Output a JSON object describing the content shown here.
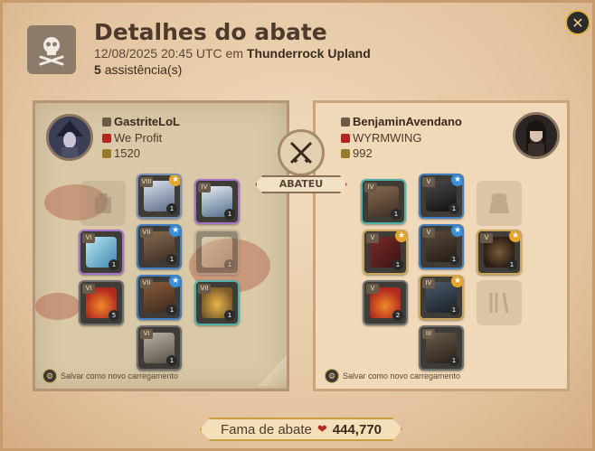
{
  "header": {
    "title": "Detalhes do abate",
    "datetime": "12/08/2025 20:45 UTC em",
    "location": "Thunderrock Upland",
    "assists_count": "5",
    "assists_label": "assistência(s)"
  },
  "killer": {
    "name": "GastriteLoL",
    "guild": "We Profit",
    "ip": "1520",
    "save_label": "Salvar como novo carregamento"
  },
  "victim": {
    "name": "BenjaminAvendano",
    "guild": "WYRMWING",
    "ip": "992",
    "save_label": "Salvar como novo carregamento"
  },
  "center": {
    "killed_label": "ABATEU"
  },
  "footer": {
    "fame_label": "Fama de abate",
    "fame_value": "444,770"
  },
  "killer_slots": {
    "bag": {
      "tier": "VII",
      "qty": "1",
      "quality": "gold"
    },
    "head": {
      "tier": "VIII",
      "qty": "1",
      "quality": "gold"
    },
    "cape": {
      "tier": "IV",
      "qty": "1",
      "quality": "purple"
    },
    "mainhand": {
      "tier": "VI",
      "qty": "1",
      "quality": "purple"
    },
    "chest": {
      "tier": "VII",
      "qty": "1",
      "quality": "blue"
    },
    "offhand": {
      "tier": "",
      "qty": "1",
      "quality": "faded"
    },
    "potion": {
      "tier": "VI",
      "qty": "5",
      "quality": "none"
    },
    "shoes": {
      "tier": "VII",
      "qty": "1",
      "quality": "blue"
    },
    "food": {
      "tier": "VII",
      "qty": "1",
      "quality": "teal"
    },
    "mount": {
      "tier": "VI",
      "qty": "1",
      "quality": "none"
    }
  },
  "victim_slots": {
    "bag": {
      "tier": "IV",
      "qty": "1",
      "quality": "teal"
    },
    "head": {
      "tier": "V",
      "qty": "1",
      "quality": "blue"
    },
    "mainhand": {
      "tier": "V",
      "qty": "1",
      "quality": "gold"
    },
    "chest": {
      "tier": "V",
      "qty": "1",
      "quality": "blue"
    },
    "offhand": {
      "tier": "V",
      "qty": "1",
      "quality": "gold"
    },
    "potion": {
      "tier": "V",
      "qty": "2",
      "quality": "none"
    },
    "shoes": {
      "tier": "IV",
      "qty": "1",
      "quality": "gold"
    },
    "mount": {
      "tier": "III",
      "qty": "1",
      "quality": "none"
    }
  },
  "colors": {
    "gold_star": "#e8a52b",
    "blue_star": "#3b8fd6",
    "blood_red": "#b3261e",
    "frame": "#c79b6b"
  }
}
